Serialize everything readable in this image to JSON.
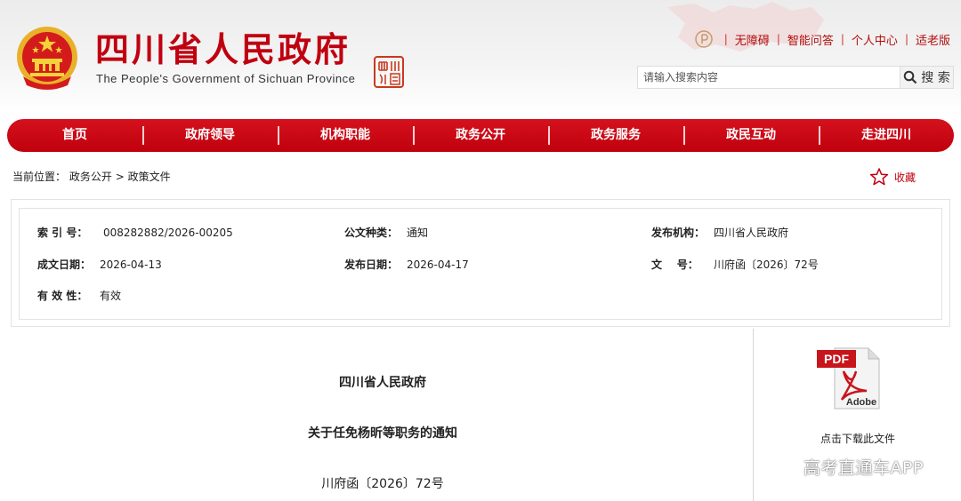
{
  "header": {
    "title": "四川省人民政府",
    "subtitle": "The People's Government of Sichuan Province",
    "seal_text": "四川印鉴",
    "top_links": [
      "无障碍",
      "智能问答",
      "个人中心",
      "适老版"
    ],
    "search": {
      "placeholder": "请输入搜索内容",
      "button_label": "搜 索"
    }
  },
  "nav": {
    "items": [
      "首页",
      "政府领导",
      "机构职能",
      "政务公开",
      "政务服务",
      "政民互动",
      "走进四川"
    ]
  },
  "breadcrumb": {
    "prefix": "当前位置：",
    "items": [
      "政务公开",
      "政策文件"
    ],
    "separator": ">"
  },
  "favorite": {
    "label": "收藏"
  },
  "info": {
    "index_label": "索 引 号：",
    "index_value": "008282882/2026-00205",
    "type_label": "公文种类：",
    "type_value": "通知",
    "issuer_label": "发布机构：",
    "issuer_value": "四川省人民政府",
    "written_label": "成文日期：",
    "written_value": "2026-04-13",
    "published_label": "发布日期：",
    "published_value": "2026-04-17",
    "docno_label": "文    号：",
    "docno_value": "川府函〔2026〕72号",
    "validity_label": "有 效 性：",
    "validity_value": "有效"
  },
  "document": {
    "org": "四川省人民政府",
    "title": "关于任免杨昕等职务的通知",
    "number": "川府函〔2026〕72号"
  },
  "download": {
    "pdf_text": "PDF",
    "adobe_text": "Adobe",
    "label": "点击下载此文件"
  },
  "watermark": "高考直通车APP",
  "colors": {
    "brand_red": "#c00010",
    "nav_red": "#c8101a"
  }
}
